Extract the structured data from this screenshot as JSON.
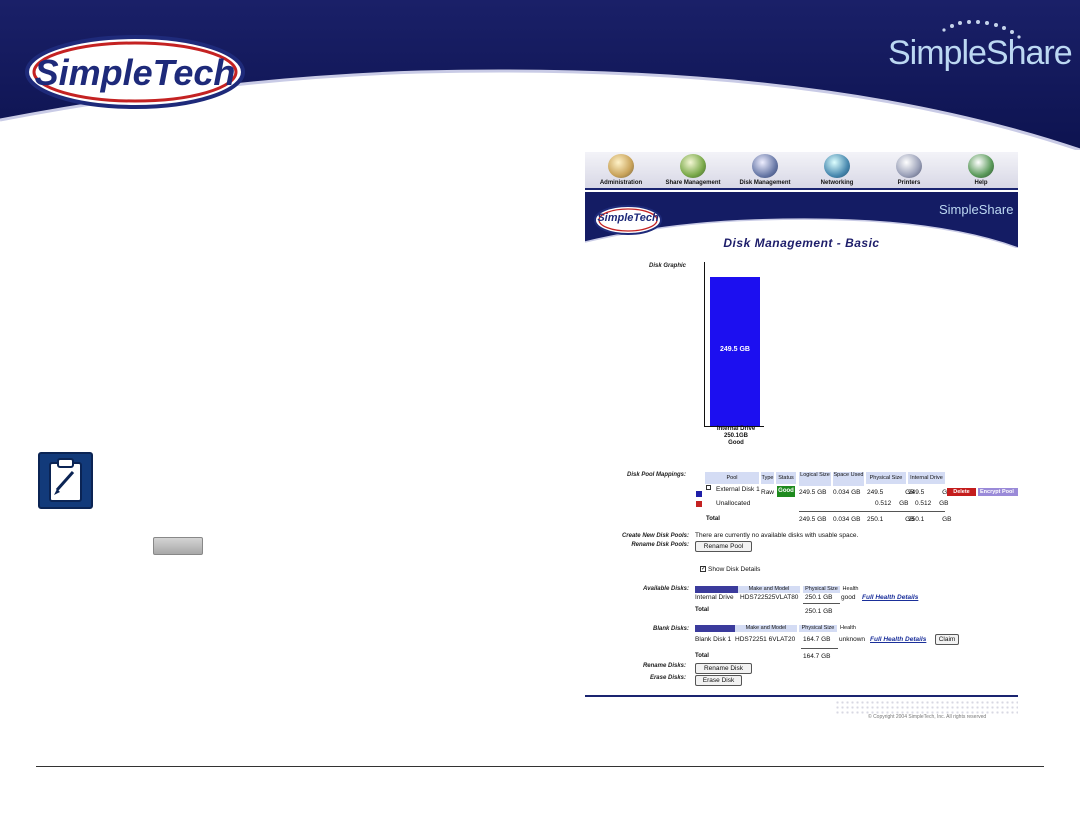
{
  "header": {
    "brand_logo_text": "SimpleTech",
    "product_logo_text": "SimpleShare"
  },
  "screenshot": {
    "nav": [
      {
        "label": "Administration",
        "icon": "administration-icon"
      },
      {
        "label": "Share Management",
        "icon": "share-management-icon"
      },
      {
        "label": "Disk Management",
        "icon": "disk-management-icon"
      },
      {
        "label": "Networking",
        "icon": "networking-icon"
      },
      {
        "label": "Printers",
        "icon": "printers-icon"
      },
      {
        "label": "Help",
        "icon": "help-icon"
      }
    ],
    "page_title": "Disk Management - Basic",
    "disk_graphic": {
      "label": "Disk Graphic",
      "bar_value": "249.5 GB",
      "drive_name": "Internal Drive",
      "drive_size": "250.1GB",
      "drive_status": "Good",
      "fill_fraction": 0.998,
      "bar_color": "#1c0ff0"
    },
    "pool_mappings": {
      "label": "Disk Pool Mappings:",
      "headers": [
        "Pool",
        "Type",
        "Status",
        "Logical Size",
        "Space Used",
        "Physical Size",
        "Internal Drive"
      ],
      "rows": [
        {
          "pool": "External Disk 1",
          "type": "Raw",
          "status": "Good",
          "logical": "249.5 GB",
          "used": "0.034 GB",
          "physical": "249.5 GB",
          "internal": "249.5 GB",
          "swatch": "#1f1fa8"
        },
        {
          "pool": "Unallocated",
          "type": "",
          "status": "",
          "logical": "",
          "used": "",
          "physical": "0.512 GB",
          "internal": "0.512 GB",
          "swatch": "#c42222"
        }
      ],
      "total_label": "Total",
      "total": {
        "logical": "249.5 GB",
        "used": "0.034 GB",
        "physical": "250.1 GB",
        "internal": "250.1 GB"
      },
      "delete_label": "Delete",
      "encrypt_label": "Encrypt Pool"
    },
    "create_pools": {
      "label": "Create New Disk Pools:",
      "text": "There are currently no available disks with usable space."
    },
    "rename_pools": {
      "label": "Rename Disk Pools:",
      "button": "Rename Pool"
    },
    "show_details": {
      "label": "Show Disk Details",
      "checked": true
    },
    "available_disks": {
      "label": "Available Disks:",
      "headers": [
        "Make and Model",
        "Physical Size",
        "Health"
      ],
      "row": {
        "name": "Internal Drive",
        "model": "HDS722525VLAT80",
        "size": "250.1 GB",
        "health": "good",
        "link": "Full Health Details"
      },
      "total_label": "Total",
      "total_size": "250.1 GB"
    },
    "blank_disks": {
      "label": "Blank Disks:",
      "headers": [
        "Make and Model",
        "Physical Size",
        "Health"
      ],
      "row": {
        "name": "Blank Disk 1",
        "model": "HDS72251 6VLAT20",
        "size": "164.7 GB",
        "health": "unknown",
        "link": "Full Health Details",
        "button": "Claim"
      },
      "total_label": "Total",
      "total_size": "164.7 GB"
    },
    "rename_disks": {
      "label": "Rename Disks:",
      "button": "Rename Disk"
    },
    "erase_disks": {
      "label": "Erase Disks:",
      "button": "Erase Disk"
    },
    "copyright": "© Copyright 2004 SimpleTech, Inc. All rights reserved"
  }
}
